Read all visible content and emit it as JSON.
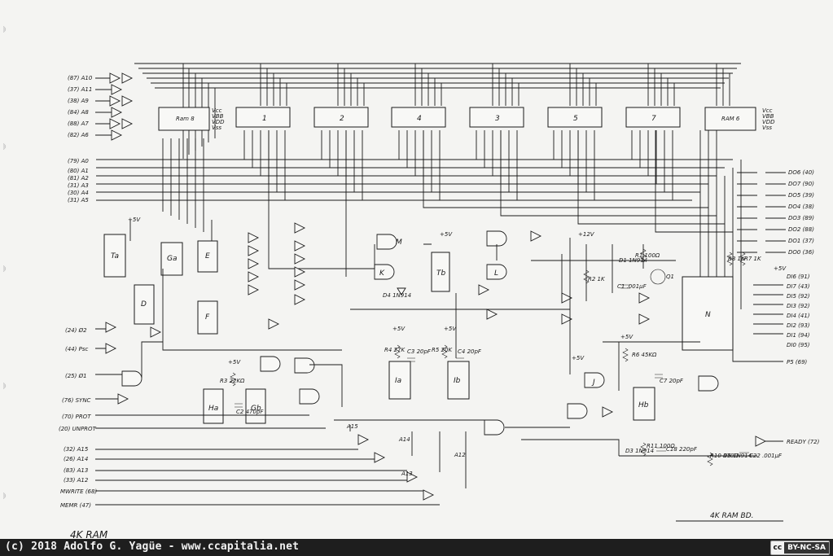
{
  "diagram": {
    "title": "4K RAM BD.",
    "handwritten_note": "4K RAM",
    "ram_left": {
      "label": "Ram 8",
      "pins": [
        "Vcc",
        "VBB",
        "VDD",
        "Vss"
      ]
    },
    "ram_right": {
      "label": "RAM 6",
      "pins": [
        "Vcc",
        "VBB",
        "VDD",
        "Vss"
      ]
    },
    "ram_chips": [
      "1",
      "2",
      "4",
      "3",
      "5",
      "7"
    ],
    "inputs_top": [
      "(87) A10",
      "(37) A11",
      "(38) A9",
      "(84) A8",
      "(88) A7",
      "(82) A6"
    ],
    "inputs_mid": [
      "(79) A0",
      "(80) A1",
      "(81) A2",
      "(31) A3",
      "(30) A4",
      "(31) A5"
    ],
    "inputs_low": [
      "(24) Ø2",
      "(44) Psc",
      "(25) Ø1",
      "(76) SYNC",
      "(70) PROT",
      "(20) UNPROT"
    ],
    "inputs_bottom": [
      "(32) A15",
      "(26) A14",
      "(83) A13",
      "(33) A12",
      "MWRITE (68)",
      "MEMR (47)"
    ],
    "data_out": [
      "DO6 (40)",
      "DO7 (90)",
      "DO5 (39)",
      "DO4 (38)",
      "DO3 (89)",
      "DO2 (88)",
      "DO1 (37)",
      "DO0 (36)"
    ],
    "data_in": [
      "DI6 (91)",
      "DI7 (43)",
      "DI5 (92)",
      "DI3 (92)",
      "DI4 (41)",
      "DI2 (93)",
      "DI1 (94)",
      "DI0 (95)"
    ],
    "other_out": [
      "P5 (69)",
      "READY (72)"
    ],
    "chip_labels": [
      "Ta",
      "Ga",
      "E",
      "D",
      "F",
      "K",
      "M",
      "L",
      "Tb",
      "Ia",
      "Ib",
      "Ha",
      "Gb",
      "Hb",
      "J",
      "N"
    ],
    "components": [
      "R1 100Ω",
      "D1 1N914",
      "C1 .001μF",
      "Q1",
      "R2 1K",
      "D4 1N914",
      "R4 27K",
      "C3 20pF",
      "R5 20K",
      "C4 20pF",
      "R3 22KΩ",
      "C2 470pF",
      "R6 45KΩ",
      "C7 20pF",
      "D3 1N914",
      "R11 100Ω",
      "C18 220pF",
      "R10 470Ω",
      "D5 1N914",
      "C22 .001μF",
      "R7 1K",
      "R8 1K"
    ],
    "supply": [
      "+5V",
      "+12V"
    ],
    "jumpers": [
      "A15",
      "A14",
      "A13",
      "A12"
    ]
  },
  "footer": {
    "credit": "(c) 2018 Adolfo G. Yagüe - www.ccapitalia.net",
    "license_cc": "cc",
    "license_text": "BY-NC-SA"
  }
}
